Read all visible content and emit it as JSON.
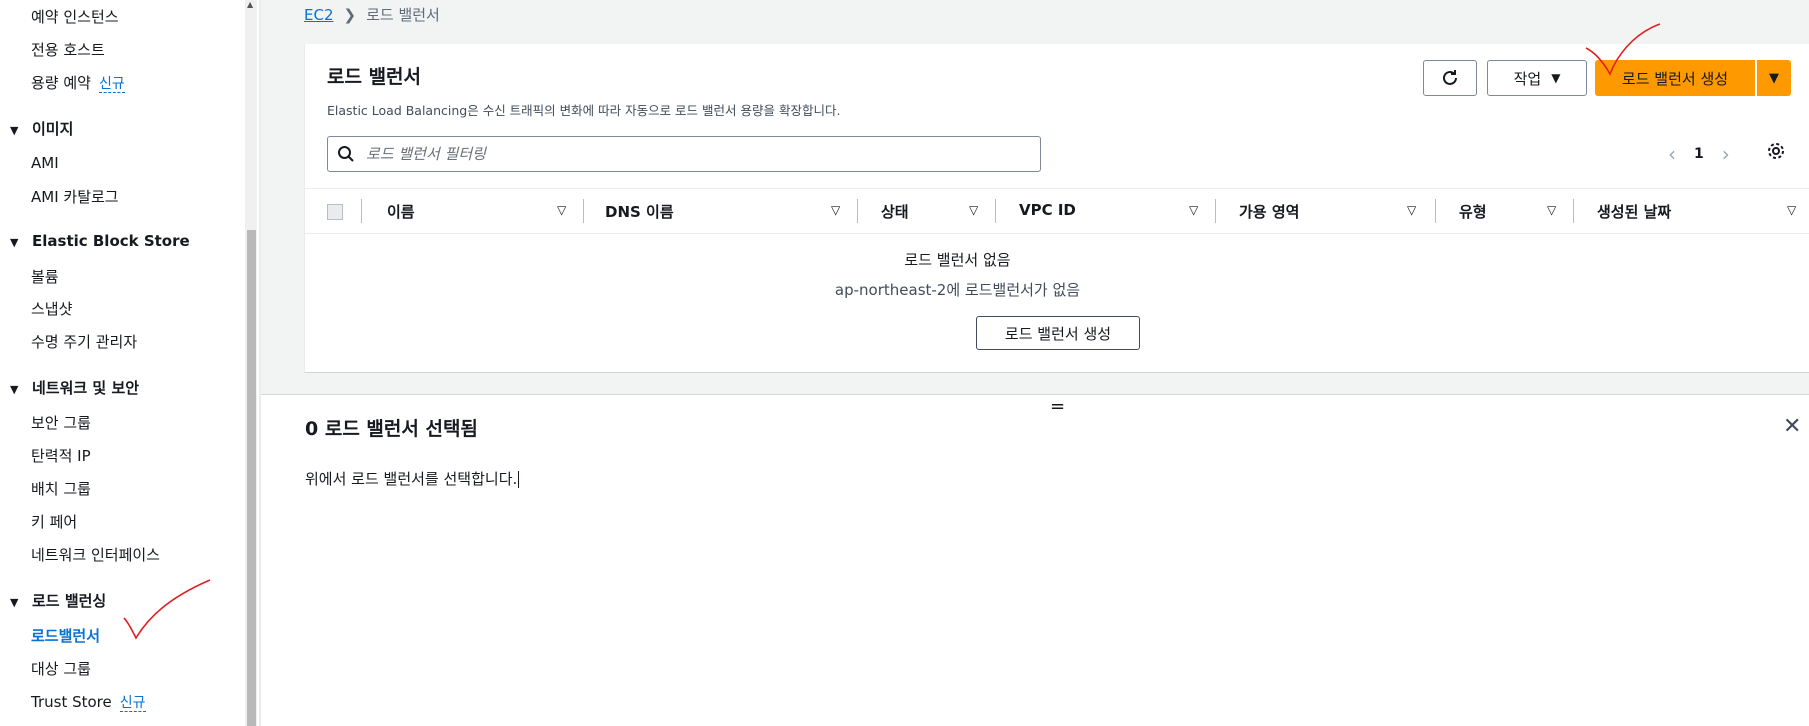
{
  "sidebar": {
    "items": [
      {
        "label": "예약 인스턴스"
      },
      {
        "label": "전용 호스트"
      },
      {
        "label": "용량 예약",
        "badge": "신규"
      }
    ],
    "sections": [
      {
        "title": "이미지",
        "items": [
          "AMI",
          "AMI 카탈로그"
        ]
      },
      {
        "title": "Elastic Block Store",
        "items": [
          "볼륨",
          "스냅샷",
          "수명 주기 관리자"
        ]
      },
      {
        "title": "네트워크 및 보안",
        "items": [
          "보안 그룹",
          "탄력적 IP",
          "배치 그룹",
          "키 페어",
          "네트워크 인터페이스"
        ]
      },
      {
        "title": "로드 밸런싱",
        "items": [
          "로드밸런서",
          "대상 그룹",
          "Trust Store"
        ],
        "trust_badge": "신규"
      }
    ]
  },
  "breadcrumb": {
    "root": "EC2",
    "current": "로드 밸런서"
  },
  "panel": {
    "title": "로드 밸런서",
    "description": "Elastic Load Balancing은 수신 트래픽의 변화에 따라 자동으로 로드 밸런서 용량을 확장합니다.",
    "actions_label": "작업",
    "create_label": "로드 밸런서 생성",
    "search_placeholder": "로드 밸런서 필터링",
    "page_number": "1",
    "columns": [
      "이름",
      "DNS 이름",
      "상태",
      "VPC ID",
      "가용 영역",
      "유형",
      "생성된 날짜"
    ],
    "empty_title": "로드 밸런서 없음",
    "empty_desc": "ap-northeast-2에 로드밸런서가 없음",
    "empty_button": "로드 밸런서 생성"
  },
  "detail": {
    "title": "0 로드 밸런서 선택됨",
    "text": "위에서 로드 밸런서를 선택합니다."
  },
  "colors": {
    "accent": "#0972d3",
    "primary_button": "#ff9900",
    "annotation": "#e02020"
  },
  "icons": [
    "refresh-icon",
    "caret-down-icon",
    "search-icon",
    "chevron-left-icon",
    "chevron-right-icon",
    "gear-icon",
    "sort-icon",
    "close-icon",
    "drag-handle-icon"
  ]
}
